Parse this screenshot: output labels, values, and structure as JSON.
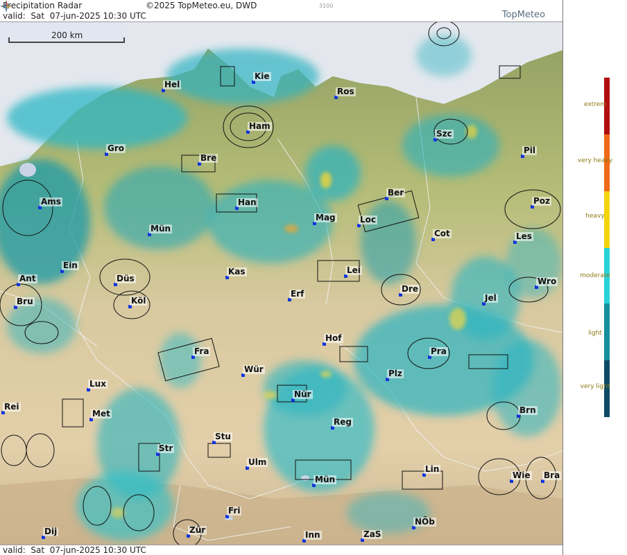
{
  "header": {
    "title": "Precipitation Radar",
    "copyright": "©2025 TopMeteo.eu, DWD",
    "valid": "valid:  Sat  07-jun-2025 10:30 UTC",
    "code": "3100",
    "brand": "TopMeteo"
  },
  "footer": {
    "valid": "valid:  Sat  07-jun-2025 10:30 UTC"
  },
  "scale": {
    "label": "200 km"
  },
  "cities": [
    {
      "id": "hel",
      "name": "Hel"
    },
    {
      "id": "kie",
      "name": "Kie"
    },
    {
      "id": "ros",
      "name": "Ros"
    },
    {
      "id": "ham",
      "name": "Ham"
    },
    {
      "id": "szc",
      "name": "Szc"
    },
    {
      "id": "gro",
      "name": "Gro"
    },
    {
      "id": "bre",
      "name": "Bre"
    },
    {
      "id": "pil",
      "name": "Pil"
    },
    {
      "id": "ber",
      "name": "Ber"
    },
    {
      "id": "ams",
      "name": "Ams"
    },
    {
      "id": "han",
      "name": "Han"
    },
    {
      "id": "poz",
      "name": "Poz"
    },
    {
      "id": "mag",
      "name": "Mag"
    },
    {
      "id": "loc",
      "name": "Loc"
    },
    {
      "id": "mun_n",
      "name": "Mün"
    },
    {
      "id": "cot",
      "name": "Cot"
    },
    {
      "id": "les",
      "name": "Les"
    },
    {
      "id": "ein",
      "name": "Ein"
    },
    {
      "id": "kas",
      "name": "Kas"
    },
    {
      "id": "lei",
      "name": "Lei"
    },
    {
      "id": "ant",
      "name": "Ant"
    },
    {
      "id": "dus",
      "name": "Düs"
    },
    {
      "id": "wro",
      "name": "Wro"
    },
    {
      "id": "bru",
      "name": "Bru"
    },
    {
      "id": "kol",
      "name": "Köl"
    },
    {
      "id": "erf",
      "name": "Erf"
    },
    {
      "id": "dre",
      "name": "Dre"
    },
    {
      "id": "jel",
      "name": "Jel"
    },
    {
      "id": "hof",
      "name": "Hof"
    },
    {
      "id": "fra",
      "name": "Fra"
    },
    {
      "id": "pra",
      "name": "Pra"
    },
    {
      "id": "wur",
      "name": "Wür"
    },
    {
      "id": "plz",
      "name": "Plz"
    },
    {
      "id": "lux",
      "name": "Lux"
    },
    {
      "id": "nur",
      "name": "Nür"
    },
    {
      "id": "rei",
      "name": "Rei"
    },
    {
      "id": "met",
      "name": "Met"
    },
    {
      "id": "reg",
      "name": "Reg"
    },
    {
      "id": "brn",
      "name": "Brn"
    },
    {
      "id": "stu",
      "name": "Stu"
    },
    {
      "id": "str",
      "name": "Str"
    },
    {
      "id": "ulm",
      "name": "Ulm"
    },
    {
      "id": "lin",
      "name": "Lin"
    },
    {
      "id": "mun_s",
      "name": "Mün"
    },
    {
      "id": "wie",
      "name": "Wie"
    },
    {
      "id": "bra",
      "name": "Bra"
    },
    {
      "id": "fri",
      "name": "Fri"
    },
    {
      "id": "nob",
      "name": "NÖb"
    },
    {
      "id": "dij",
      "name": "Dij"
    },
    {
      "id": "zur",
      "name": "Zür"
    },
    {
      "id": "inn",
      "name": "Inn"
    },
    {
      "id": "zas",
      "name": "ZaS"
    }
  ],
  "legend": [
    {
      "label": "extrem",
      "color": "#b00f0f"
    },
    {
      "label": "very heavy",
      "color": "#ee6a16"
    },
    {
      "label": "heavy",
      "color": "#f5d40e"
    },
    {
      "label": "moderate",
      "color": "#27d3d9"
    },
    {
      "label": "light",
      "color": "#148f9c"
    },
    {
      "label": "very light",
      "color": "#0d4a66"
    }
  ]
}
